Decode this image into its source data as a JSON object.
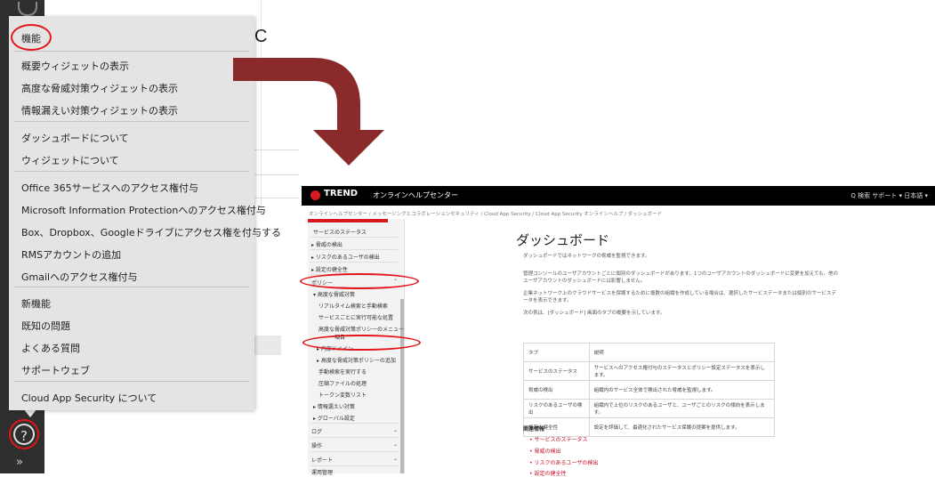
{
  "rail": {
    "help_glyph": "?",
    "more_glyph": "»"
  },
  "background": {
    "heading_fragment": "C"
  },
  "menu": {
    "items": [
      "機能",
      "概要ウィジェットの表示",
      "高度な脅威対策ウィジェットの表示",
      "情報漏えい対策ウィジェットの表示",
      "ダッシュボードについて",
      "ウィジェットについて",
      "Office 365サービスへのアクセス権付与",
      "Microsoft Information Protectionへのアクセス権付与",
      "Box、Dropbox、Googleドライブにアクセス権を付与する",
      "RMSアカウントの追加",
      "Gmailへのアクセス権付与",
      "新機能",
      "既知の問題",
      "よくある質問",
      "サポートウェブ",
      "Cloud App Security について"
    ]
  },
  "help_center": {
    "logo": "TREND",
    "site_title": "オンラインヘルプセンター",
    "top_right": "Q 検索   サポート ▾   日本語 ▾",
    "breadcrumb": "オンラインヘルプセンター / メッセージングとコラボレーションセキュリティ / Cloud App Security / Cloud App Security オンラインヘルプ / ダッシュボード",
    "sidebar": [
      "サービスのステータス",
      "▸ 脅威の検出",
      "▸ リスクのあるユーザの検出",
      "▸ 設定の健全性",
      "ポリシー",
      "▾ 高度な脅威対策",
      "リアルタイム検索と手動検索",
      "サービスごとに実行可能な処置",
      "高度な脅威対策ポリシーのメニュー",
      "項目",
      "▸ 内部ドメイン",
      "▸ 高度な脅威対策ポリシーの追加",
      "手動検索を実行する",
      "圧縮ファイルの処理",
      "トークン変数リスト",
      "▸ 情報漏えい対策",
      "▸ グローバル設定",
      "ログ",
      "操作",
      "レポート",
      "運用管理"
    ],
    "page_title": "ダッシュボード",
    "intro": "ダッシュボードではネットワークの脅威を監視できます。",
    "paragraphs": [
      "管理コンソールのユーザアカウントごとに個別のダッシュボードがあります。1つのユーザアカウントのダッシュボードに変更を加えても、他の",
      "ユーザアカウントのダッシュボードには影響しません。",
      "企業ネットワーク上のクラウドサービスを保護するために複数の組織を作成している場合は、選択したサービスデータまたは個別のサービスデ",
      "ータを表示できます。",
      "次の表は、[ダッシュボード] 画面のタブの概要を示しています。"
    ],
    "table": [
      [
        "タブ",
        "説明"
      ],
      [
        "サービスのステータス",
        "サービスへのアクセス権付与のステータスとポリシー設定ステータスを表示します。"
      ],
      [
        "脅威の検出",
        "組織内のサービス全体で検出された脅威を監視します。"
      ],
      [
        "リスクのあるユーザの検出",
        "組織内で上位のリスクのあるユーザと、ユーザごとのリスクの傾向を表示します。"
      ],
      [
        "設定の健全性",
        "設定を評価して、最適化されたサービス保護の提案を提供します。"
      ]
    ],
    "related_heading": "関連情報",
    "related_links": [
      "サービスのステータス",
      "脅威の検出",
      "リスクのあるユーザの検出",
      "設定の健全性"
    ]
  },
  "colors": {
    "annotation_red": "#e3161b",
    "arrow": "#8b2a2a",
    "brand_red": "#d71920"
  }
}
